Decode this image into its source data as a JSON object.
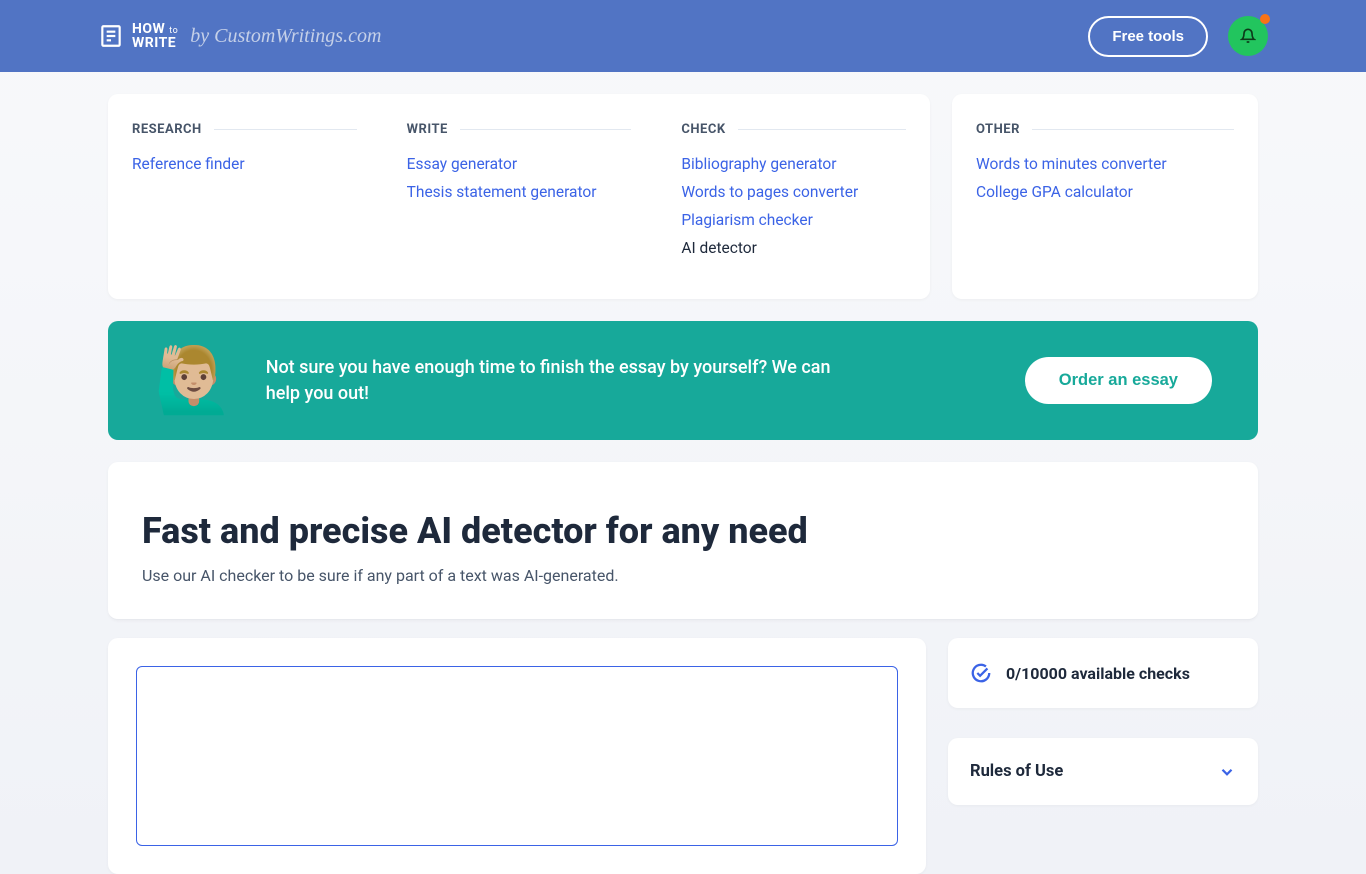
{
  "header": {
    "logo_main": "HOW",
    "logo_small": "to",
    "logo_sub": "WRITE",
    "logo_by": "by CustomWritings.com",
    "free_tools": "Free tools"
  },
  "categories": {
    "research": {
      "heading": "RESEARCH",
      "items": [
        "Reference finder"
      ]
    },
    "write": {
      "heading": "WRITE",
      "items": [
        "Essay generator",
        "Thesis statement generator"
      ]
    },
    "check": {
      "heading": "CHECK",
      "items": [
        "Bibliography generator",
        "Words to pages converter",
        "Plagiarism checker",
        "AI detector"
      ]
    },
    "other": {
      "heading": "OTHER",
      "items": [
        "Words to minutes converter",
        "College GPA calculator"
      ]
    }
  },
  "cta": {
    "text": "Not sure you have enough time to finish the essay by yourself? We can help you out!",
    "button": "Order an essay"
  },
  "hero": {
    "title": "Fast and precise AI detector for any need",
    "subtitle": "Use our AI checker to be sure if any part of a text was AI-generated."
  },
  "side": {
    "checks": "0/10000 available checks",
    "rules": "Rules of Use"
  }
}
